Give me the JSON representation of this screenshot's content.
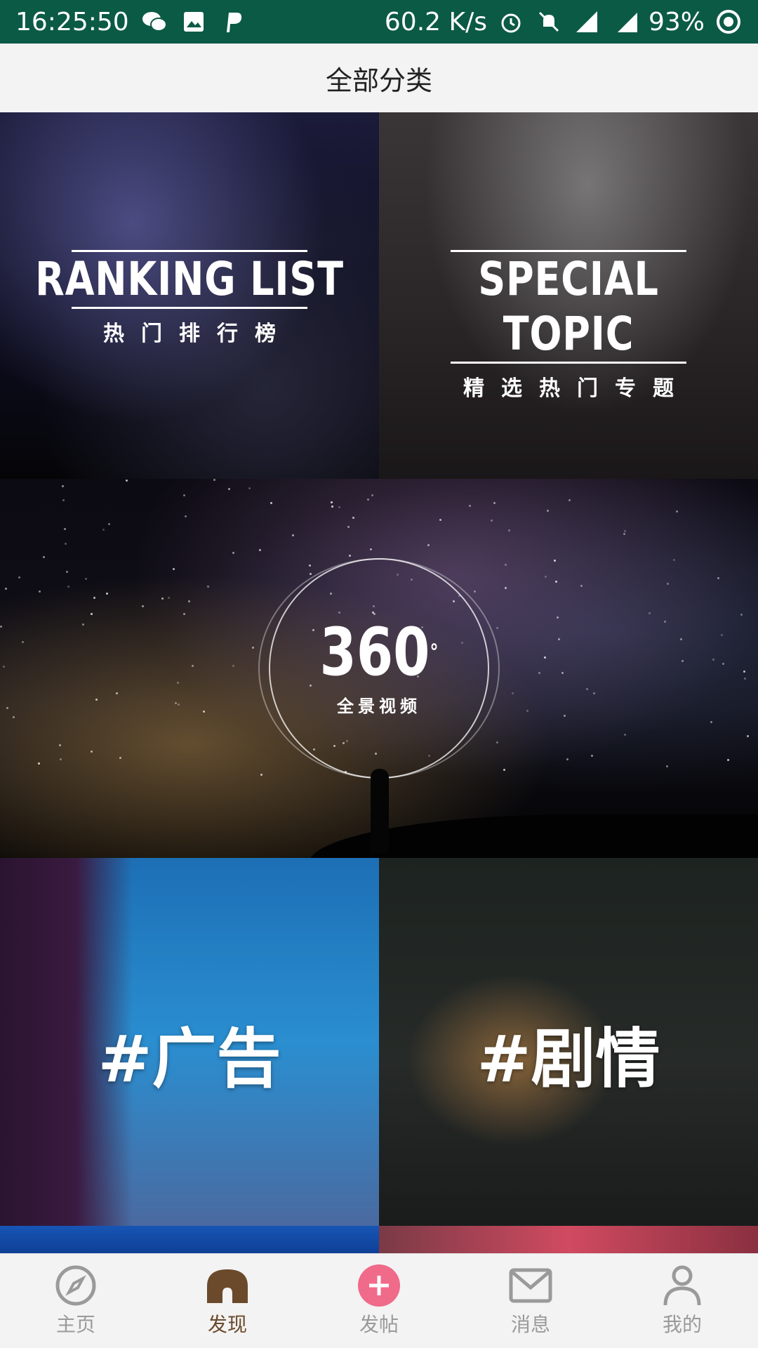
{
  "status_bar": {
    "time": "16:25:50",
    "network_speed": "60.2 K/s",
    "battery": "93%",
    "left_icons": [
      "wechat-icon",
      "image-icon",
      "p-app-icon"
    ],
    "right_icons": [
      "alarm-icon",
      "mute-icon",
      "signal-icon",
      "4g-signal-icon",
      "battery-icon"
    ]
  },
  "header": {
    "title": "全部分类"
  },
  "tiles": {
    "ranking": {
      "en": "RANKING LIST",
      "zh": "热门排行榜"
    },
    "special": {
      "en": "SPECIAL TOPIC",
      "zh": "精选热门专题"
    },
    "panorama": {
      "number": "360",
      "degree": "°",
      "zh": "全景视频"
    },
    "ads": {
      "label": "#广告"
    },
    "drama": {
      "label": "#剧情"
    }
  },
  "bottom_nav": {
    "items": [
      {
        "label": "主页",
        "icon": "compass-icon",
        "active": false
      },
      {
        "label": "发现",
        "icon": "home-icon",
        "active": true
      },
      {
        "label": "发帖",
        "icon": "plus-circle-icon",
        "active": false
      },
      {
        "label": "消息",
        "icon": "mail-icon",
        "active": false
      },
      {
        "label": "我的",
        "icon": "user-icon",
        "active": false
      }
    ]
  },
  "colors": {
    "status_bar": "#0b5a46",
    "nav_active": "#6b4a2c",
    "post_button": "#f06a8a"
  }
}
